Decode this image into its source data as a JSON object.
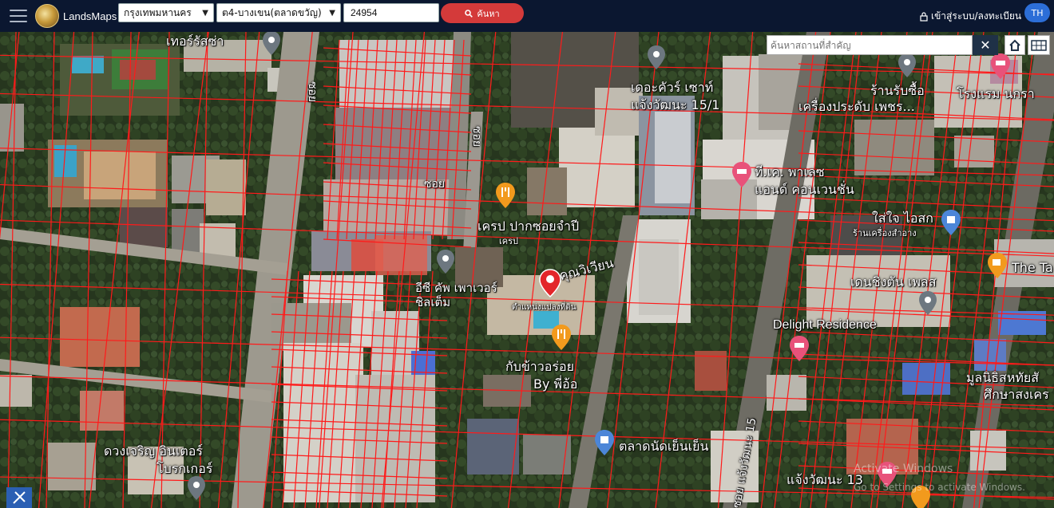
{
  "header": {
    "brand": "LandsMaps",
    "province": "กรุงเทพมหานคร",
    "district": "ต4-บางเขน(ตลาดขวัญ)",
    "parcel_number": "24954",
    "search_button": "ค้นหา",
    "login_label": "เข้าสู่ระบบ/ลงทะเบียน",
    "language": "TH"
  },
  "map": {
    "place_search_placeholder": "ค้นหาสถานที่สำคัญ",
    "labels": {
      "l1": "เดอะคัวร์ เซาท์",
      "l2": "แจ้งวัฒนะ 15/1",
      "l3": "ร้านรับซื้อ",
      "l4": "โรงแรม นกรา",
      "l5": "เครื่องประดับ เพชร...",
      "l6": "ที.เค. พาเลซ",
      "l7": "แอนด์ คอนเวนชั่น",
      "l8": "ใส่ใจ ไอสก",
      "l9": "ร้านเครื่องสำอาง",
      "l10": "เครป ปากซอยจำปี",
      "l11": "เครป",
      "l12": "คุณวิเวียน",
      "l13": "อีซี คัพ เพาเวอร์ ชิลเต็ม",
      "l14": "ตำแหน่งแปลงที่ดิน",
      "l15": "The Ta",
      "l16": "เดนชิงตัน เพลส",
      "l17": "Delight Residence",
      "l18": "กับข้าวอร่อย",
      "l19": "By พี่อ้อ",
      "l20": "มูลนิธิสหทัยสั",
      "l21": "ศึกษาสงเคร",
      "l22": "ตลาดนัดเย็นเย็น",
      "l23": "ดวงเจริญ อินเตอร์",
      "l24": "โบรกเกอร์",
      "l25": "แจ้งวัฒนะ 13",
      "l26": "ซอย แจ้งวัฒนะ 15",
      "l27": "ซอย",
      "l28": "ซอย",
      "l29": "ซอย",
      "l30": "เทอร์รัสซ่า",
      "watermark": "Activate Windows",
      "watermark2": "Go to Settings to activate Windows."
    }
  },
  "colors": {
    "topbar": "#0b1730",
    "search_button": "#d43a3a",
    "language_badge": "#2c6ed7",
    "parcel_lines": "#ff1a1a",
    "marker": "#e3262a"
  }
}
